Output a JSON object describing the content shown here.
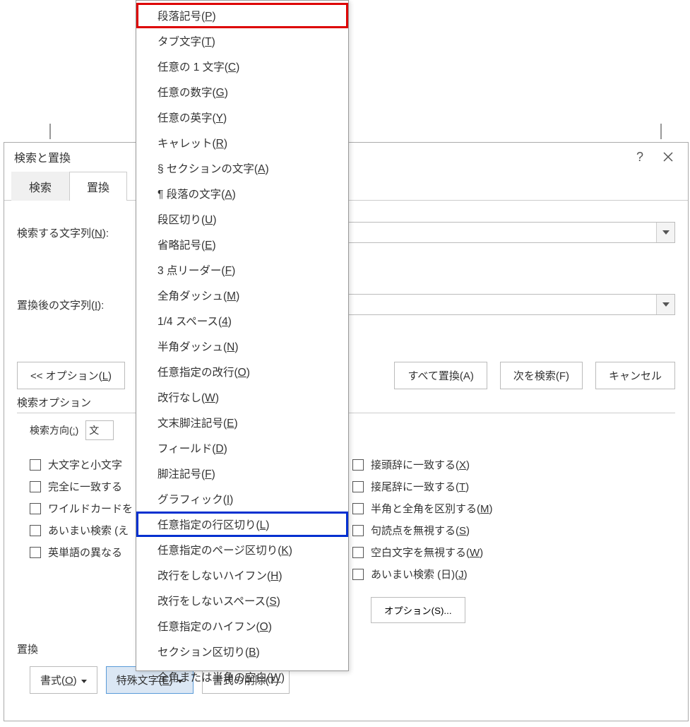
{
  "dialog": {
    "title": "検索と置換",
    "tabs": {
      "search": "検索",
      "replace": "置換"
    },
    "fields": {
      "find_label_pre": "検索する文字列(",
      "find_label_u": "N",
      "find_label_post": "):",
      "replace_label_pre": "置換後の文字列(",
      "replace_label_u": "I",
      "replace_label_post": "):"
    },
    "buttons": {
      "options_pre": "<< オプション(",
      "options_u": "L",
      "options_post": ")",
      "replace_all": "すべて置換(A)",
      "find_next": "次を検索(F)",
      "cancel": "キャンセル"
    },
    "section_options": "検索オプション",
    "direction_label_pre": "検索方向(",
    "direction_label_u": ":",
    "direction_label_post": ")",
    "direction_value": "文",
    "left_checks": [
      "大文字と小文字",
      "完全に一致する",
      "ワイルドカードを",
      "あいまい検索 (え",
      "英単語の異なる"
    ],
    "right_checks": [
      {
        "pre": "接頭辞に一致する(",
        "u": "X",
        "post": ")"
      },
      {
        "pre": "接尾辞に一致する(",
        "u": "T",
        "post": ")"
      },
      {
        "pre": "半角と全角を区別する(",
        "u": "M",
        "post": ")"
      },
      {
        "pre": "句読点を無視する(",
        "u": "S",
        "post": ")"
      },
      {
        "pre": "空白文字を無視する(",
        "u": "W",
        "post": ")"
      },
      {
        "pre": "あいまい検索 (日)(",
        "u": "J",
        "post": ")"
      }
    ],
    "options_btn": "オプション(S)...",
    "replace_section": "置換",
    "bottom_buttons": {
      "format_pre": "書式(",
      "format_u": "O",
      "format_post": ")",
      "special_pre": "特殊文字(",
      "special_u": "E",
      "special_post": ")",
      "clear": "書式の削除(T)"
    }
  },
  "menu": [
    {
      "pre": "段落記号(",
      "u": "P",
      "post": ")",
      "hl": "red"
    },
    {
      "pre": "タブ文字(",
      "u": "T",
      "post": ")"
    },
    {
      "pre": "任意の 1 文字(",
      "u": "C",
      "post": ")"
    },
    {
      "pre": "任意の数字(",
      "u": "G",
      "post": ")"
    },
    {
      "pre": "任意の英字(",
      "u": "Y",
      "post": ")"
    },
    {
      "pre": "キャレット(",
      "u": "R",
      "post": ")"
    },
    {
      "pre": "§ セクションの文字(",
      "u": "A",
      "post": ")"
    },
    {
      "pre": "¶ 段落の文字(",
      "u": "A",
      "post": ")"
    },
    {
      "pre": "段区切り(",
      "u": "U",
      "post": ")"
    },
    {
      "pre": "省略記号(",
      "u": "E",
      "post": ")"
    },
    {
      "pre": "3 点リーダー(",
      "u": "F",
      "post": ")"
    },
    {
      "pre": "全角ダッシュ(",
      "u": "M",
      "post": ")"
    },
    {
      "pre": "1/4 スペース(",
      "u": "4",
      "post": ")"
    },
    {
      "pre": "半角ダッシュ(",
      "u": "N",
      "post": ")"
    },
    {
      "pre": "任意指定の改行(",
      "u": "O",
      "post": ")"
    },
    {
      "pre": "改行なし(",
      "u": "W",
      "post": ")"
    },
    {
      "pre": "文末脚注記号(",
      "u": "E",
      "post": ")"
    },
    {
      "pre": "フィールド(",
      "u": "D",
      "post": ")"
    },
    {
      "pre": "脚注記号(",
      "u": "F",
      "post": ")"
    },
    {
      "pre": "グラフィック(",
      "u": "I",
      "post": ")"
    },
    {
      "pre": "任意指定の行区切り(",
      "u": "L",
      "post": ")",
      "hl": "blue"
    },
    {
      "pre": "任意指定のページ区切り(",
      "u": "K",
      "post": ")"
    },
    {
      "pre": "改行をしないハイフン(",
      "u": "H",
      "post": ")"
    },
    {
      "pre": "改行をしないスペース(",
      "u": "S",
      "post": ")"
    },
    {
      "pre": "任意指定のハイフン(",
      "u": "O",
      "post": ")"
    },
    {
      "pre": "セクション区切り(",
      "u": "B",
      "post": ")"
    },
    {
      "pre": "全角または半角の空白(",
      "u": "W",
      "post": ")"
    }
  ]
}
